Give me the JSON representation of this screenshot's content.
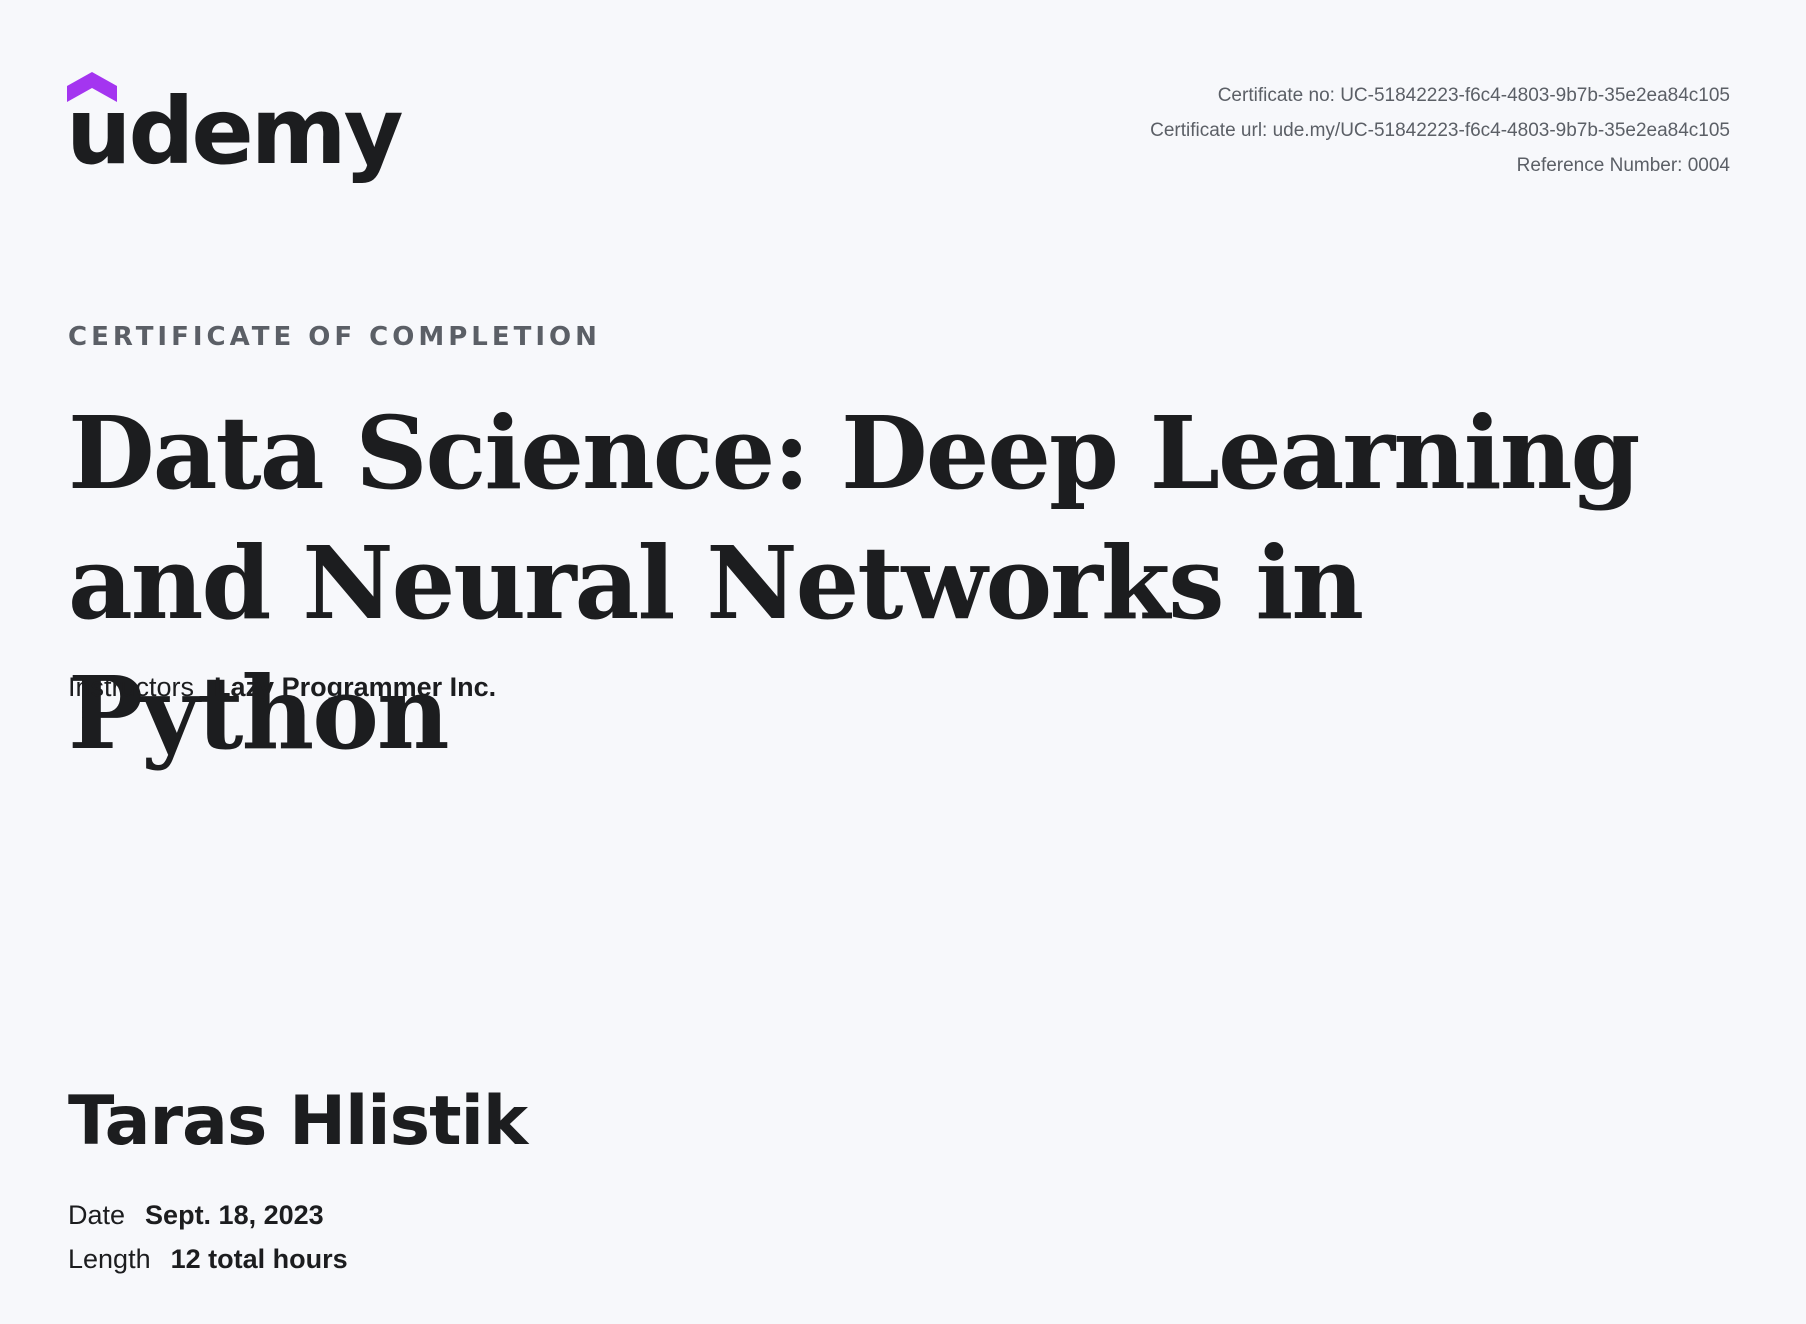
{
  "logo": {
    "text": "udemy",
    "icon": "udemy-hat-icon",
    "hat_color": "#a435f0"
  },
  "certificate_meta": {
    "number": "Certificate no: UC-51842223-f6c4-4803-9b7b-35e2ea84c105",
    "url": "Certificate url: ude.my/UC-51842223-f6c4-4803-9b7b-35e2ea84c105",
    "reference": "Reference Number: 0004"
  },
  "heading": {
    "kicker": "CERTIFICATE OF COMPLETION",
    "course_title": "Data Science: Deep Learning and Neural Networks in Python"
  },
  "instructors": {
    "label": "Instructors",
    "value": "Lazy Programmer Inc."
  },
  "recipient": {
    "name": "Taras Hlistik"
  },
  "details": {
    "date_label": "Date",
    "date_value": "Sept. 18, 2023",
    "length_label": "Length",
    "length_value": "12 total hours"
  },
  "colors": {
    "background": "#f7f8fb",
    "text": "#1c1d1f",
    "muted": "#5b5f66",
    "brand_purple": "#a435f0"
  }
}
